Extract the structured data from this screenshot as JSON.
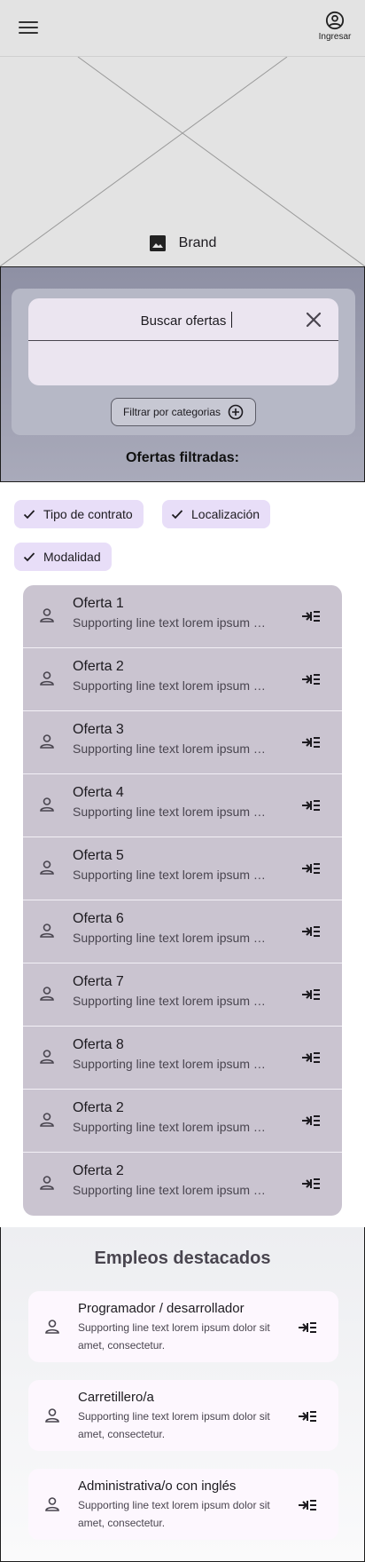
{
  "header": {
    "login_label": "Ingresar"
  },
  "hero": {
    "brand": "Brand"
  },
  "search": {
    "placeholder": "Buscar ofertas",
    "value": "Buscar ofertas",
    "filter_button_label": "Filtrar por categorias",
    "results_title": "Ofertas filtradas:"
  },
  "chips": [
    {
      "label": "Tipo de contrato",
      "selected": true
    },
    {
      "label": "Localización",
      "selected": true
    },
    {
      "label": "Modalidad",
      "selected": true
    }
  ],
  "offers": [
    {
      "title": "Oferta 1",
      "subtitle": "Supporting line text lorem ipsum dolor sit amet, consectetur."
    },
    {
      "title": "Oferta 2",
      "subtitle": "Supporting line text lorem ipsum dolor sit amet, consectetur."
    },
    {
      "title": "Oferta 3",
      "subtitle": "Supporting line text lorem ipsum dolor sit amet, consectetur."
    },
    {
      "title": "Oferta 4",
      "subtitle": "Supporting line text lorem ipsum dolor sit amet, consectetur."
    },
    {
      "title": "Oferta 5",
      "subtitle": "Supporting line text lorem ipsum dolor sit amet, consectetur."
    },
    {
      "title": "Oferta 6",
      "subtitle": "Supporting line text lorem ipsum dolor sit amet, consectetur."
    },
    {
      "title": "Oferta 7",
      "subtitle": "Supporting line text lorem ipsum dolor sit amet, consectetur."
    },
    {
      "title": "Oferta 8",
      "subtitle": "Supporting line text lorem ipsum dolor sit amet, consectetur."
    },
    {
      "title": "Oferta 2",
      "subtitle": "Supporting line text lorem ipsum dolor sit amet, consectetur."
    },
    {
      "title": "Oferta 2",
      "subtitle": "Supporting line text lorem ipsum dolor sit amet, consectetur."
    }
  ],
  "featured": {
    "title": "Empleos destacados",
    "items": [
      {
        "title": "Programador / desarrollador",
        "subtitle": "Supporting line text lorem ipsum dolor sit amet, consectetur."
      },
      {
        "title": "Carretillero/a",
        "subtitle": "Supporting line text lorem ipsum dolor sit amet, consectetur."
      },
      {
        "title": "Administrativa/o con inglés",
        "subtitle": "Supporting line text lorem ipsum dolor sit amet, consectetur."
      }
    ]
  },
  "icons": {
    "menu": "menu-icon",
    "account": "account-circle-icon",
    "image": "image-icon",
    "close": "close-icon",
    "add": "add-circle-icon",
    "check": "check-icon",
    "person": "person-icon",
    "enter": "enter-list-icon"
  },
  "colors": {
    "top_bar": "#e3e3e3",
    "search_field": "#ebe5f0",
    "chip": "#e8def8",
    "list_bg": "#cac4d0",
    "featured_card": "#fdf7fe"
  }
}
